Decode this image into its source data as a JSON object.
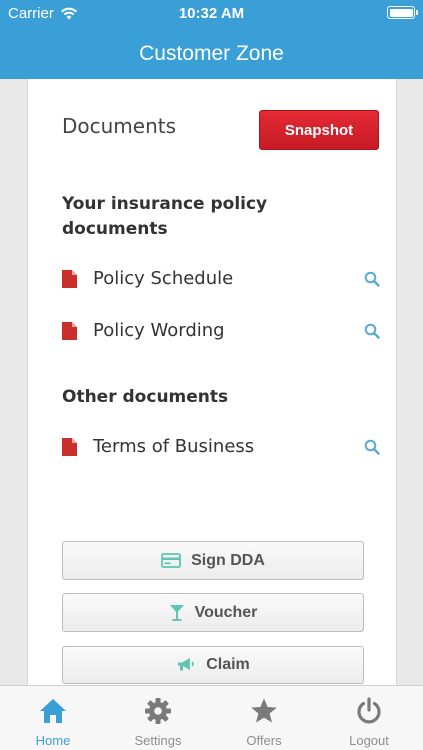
{
  "status_bar": {
    "carrier": "Carrier",
    "time": "10:32 AM"
  },
  "header": {
    "title": "Customer Zone"
  },
  "main": {
    "heading": "Documents",
    "snapshot_label": "Snapshot",
    "policy_section_title": "Your insurance policy documents",
    "policy_docs": [
      "Policy Schedule",
      "Policy Wording"
    ],
    "other_section_title": "Other documents",
    "other_docs": [
      "Terms of Business"
    ]
  },
  "actions": {
    "sign_dda": "Sign DDA",
    "voucher": "Voucher",
    "claim": "Claim"
  },
  "tabs": [
    {
      "label": "Home",
      "icon": "home-icon"
    },
    {
      "label": "Settings",
      "icon": "gear-icon"
    },
    {
      "label": "Offers",
      "icon": "star-icon"
    },
    {
      "label": "Logout",
      "icon": "power-icon"
    }
  ],
  "colors": {
    "brand_blue": "#3b9fd7",
    "snapshot_red": "#d9222c",
    "pdf_red": "#c9302c",
    "icon_teal": "#5fc4b1",
    "search_blue": "#5aa9d6"
  }
}
